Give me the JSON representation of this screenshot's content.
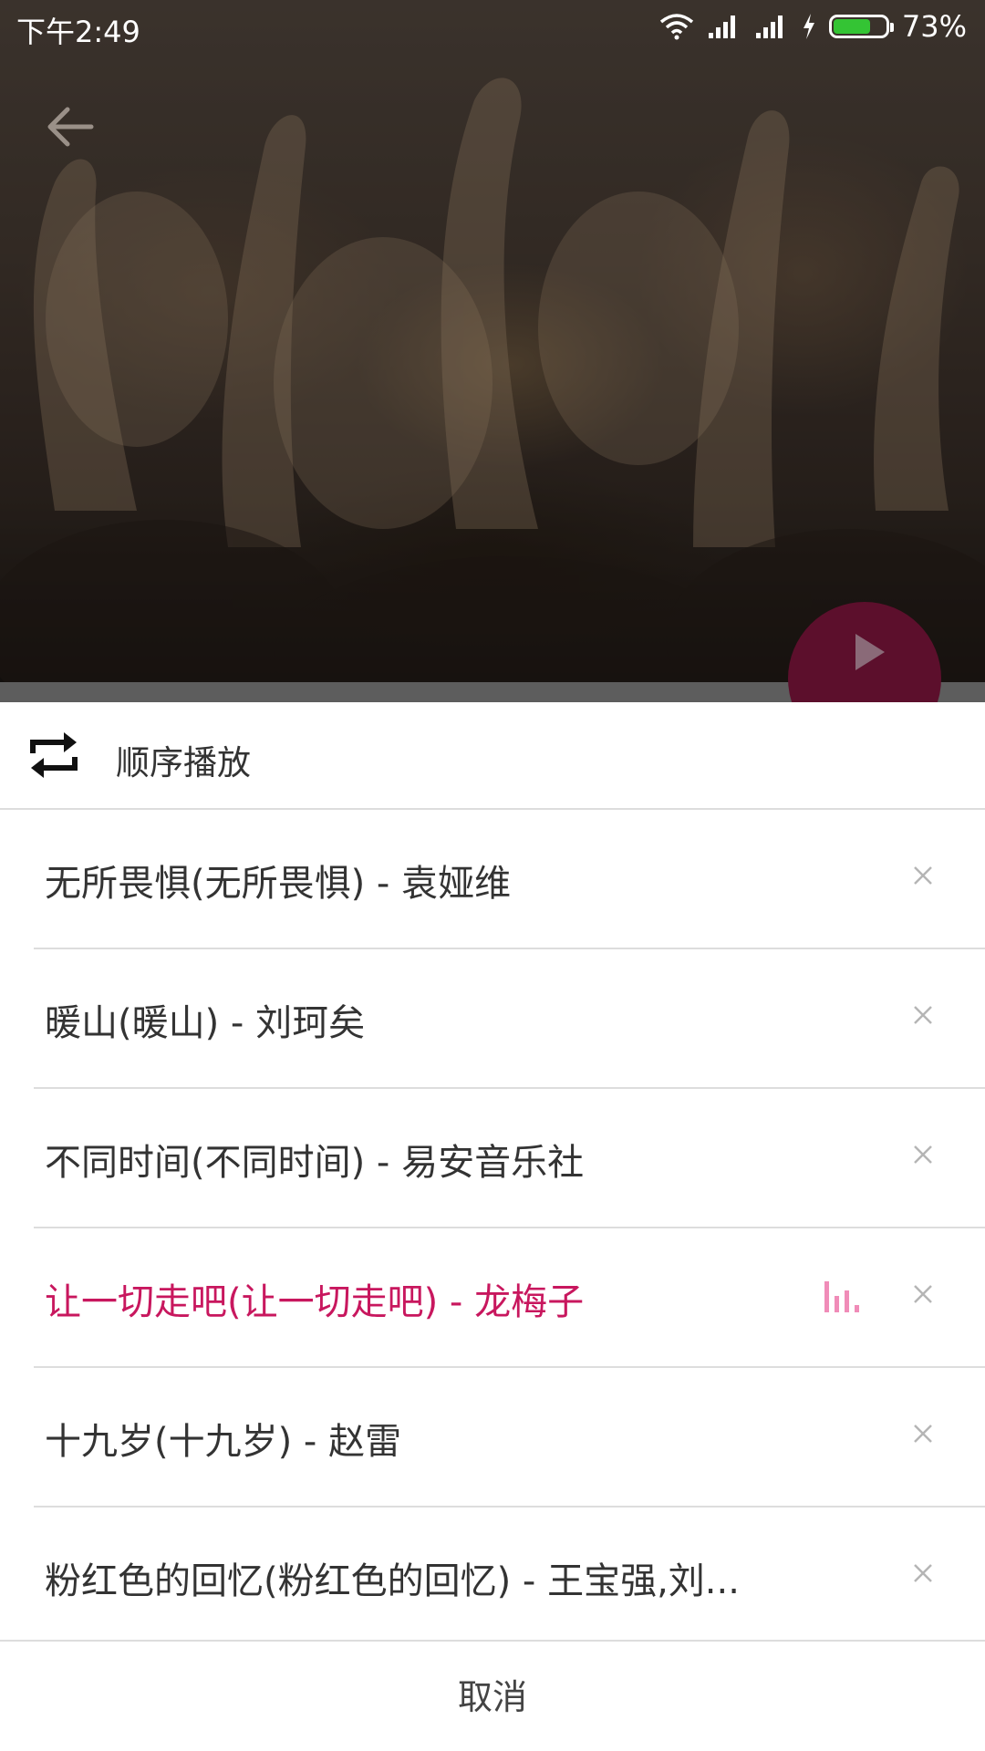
{
  "status_bar": {
    "time": "下午2:49",
    "battery_text": "73%",
    "battery_level": 0.73
  },
  "header": {
    "back_icon": "arrow-left-icon"
  },
  "player": {
    "play_icon": "play-icon"
  },
  "playlist_sheet": {
    "mode_icon": "repeat-icon",
    "mode_label": "顺序播放",
    "songs": [
      {
        "title": "无所畏惧(无所畏惧) - 袁娅维",
        "playing": false
      },
      {
        "title": "暖山(暖山) - 刘珂矣",
        "playing": false
      },
      {
        "title": "不同时间(不同时间) - 易安音乐社",
        "playing": false
      },
      {
        "title": "让一切走吧(让一切走吧) - 龙梅子",
        "playing": true
      },
      {
        "title": "十九岁(十九岁) - 赵雷",
        "playing": false
      },
      {
        "title": "粉红色的回忆(粉红色的回忆) - 王宝强,刘...",
        "playing": false
      }
    ],
    "remove_icon": "close-icon",
    "playing_indicator_icon": "equalizer-icon",
    "cancel_label": "取消"
  },
  "colors": {
    "accent": "#c8175e",
    "equalizer": "#f08cb8",
    "fab": "#5c0f2c",
    "battery_fill": "#34c434"
  }
}
